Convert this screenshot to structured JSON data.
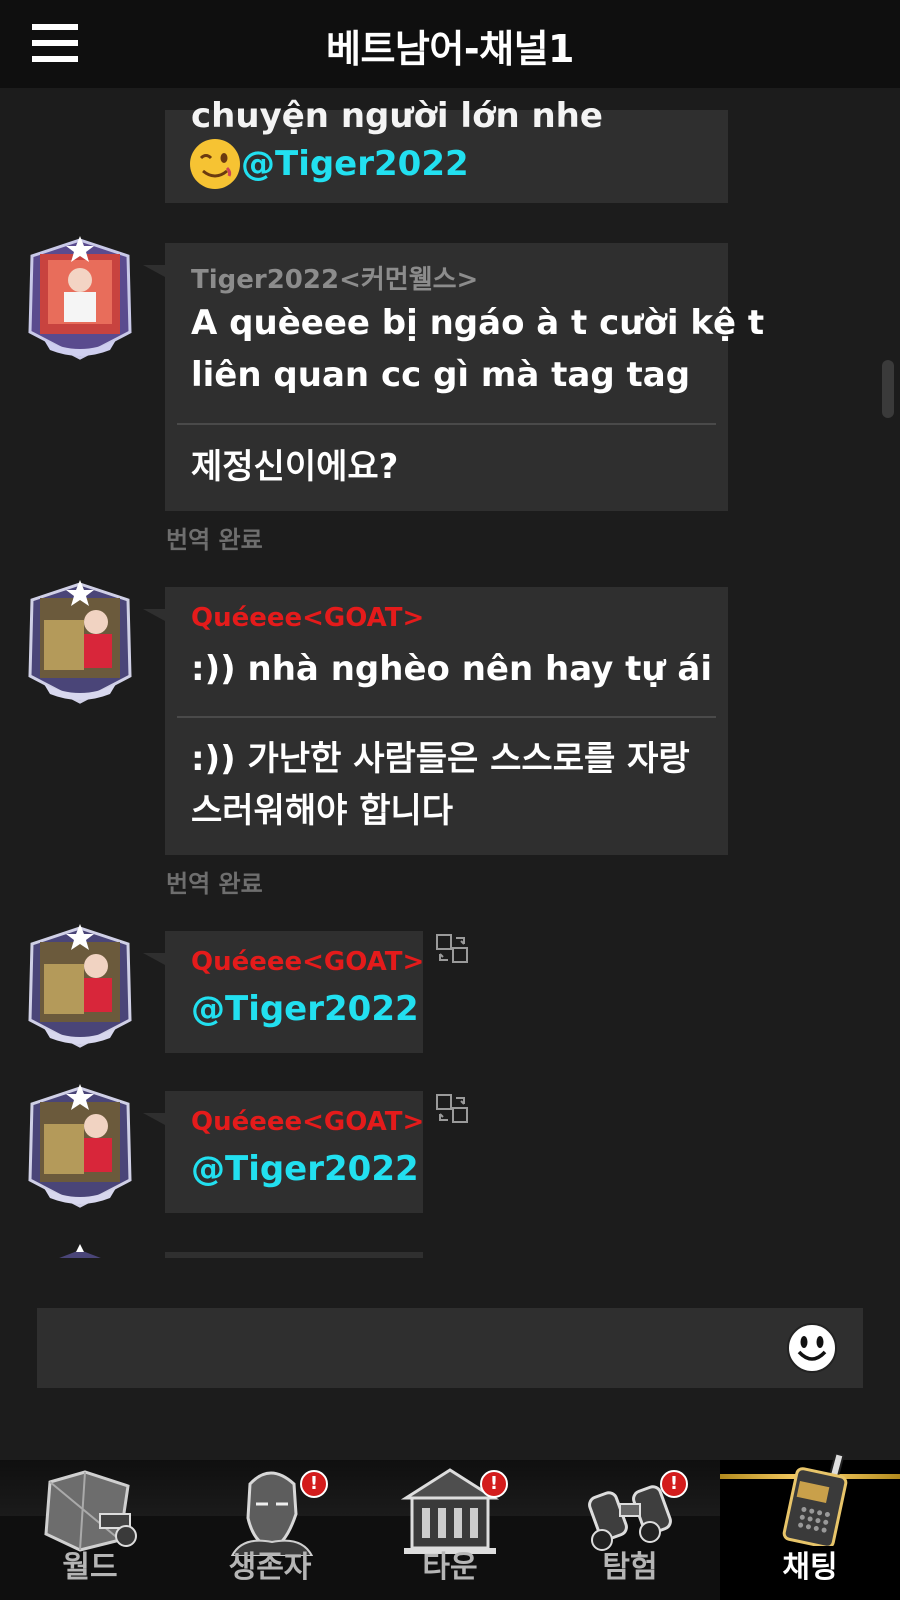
{
  "header": {
    "title": "베트남어-채널1"
  },
  "messages": [
    {
      "partial_text": "chuyện người lớn nhe",
      "mention": "@Tiger2022"
    },
    {
      "sender": "Tiger2022<커먼웰스>",
      "original_lines": [
        "A quèeee bị ngáo à t cười kệ t",
        "liên quan cc gì mà tag tag"
      ],
      "translated_lines": [
        "제정신이에요?"
      ],
      "status": "번역 완료"
    },
    {
      "sender": "Quéeee<GOAT>",
      "original_lines": [
        ":)) nhà nghèo nên hay tự ái"
      ],
      "translated_lines": [
        ":)) 가난한 사람들은 스스로를 자랑",
        "스러워해야 합니다"
      ],
      "status": "번역 완료"
    },
    {
      "sender": "Quéeee<GOAT>",
      "mention": "@Tiger2022"
    },
    {
      "sender": "Quéeee<GOAT>",
      "mention": "@Tiger2022"
    }
  ],
  "input": {
    "placeholder": ""
  },
  "nav": {
    "items": [
      {
        "label": "월드",
        "icon": "world-map-icon",
        "badge": false
      },
      {
        "label": "생존자",
        "icon": "survivor-icon",
        "badge": true
      },
      {
        "label": "타운",
        "icon": "town-icon",
        "badge": true
      },
      {
        "label": "탐험",
        "icon": "binoculars-icon",
        "badge": true
      },
      {
        "label": "채팅",
        "icon": "walkie-talkie-icon",
        "badge": false,
        "active": true
      }
    ],
    "badge_mark": "!"
  },
  "colors": {
    "header_bg": "#0f0f0f",
    "chat_bg": "#1c1c1c",
    "bubble_bg": "#2f2f2f",
    "mention": "#22e0f0",
    "sender_red": "#e41b1b",
    "sender_gray": "#8c8c8c",
    "active_tab_gold": "#ffd46b",
    "badge_red": "#d31c1c"
  }
}
